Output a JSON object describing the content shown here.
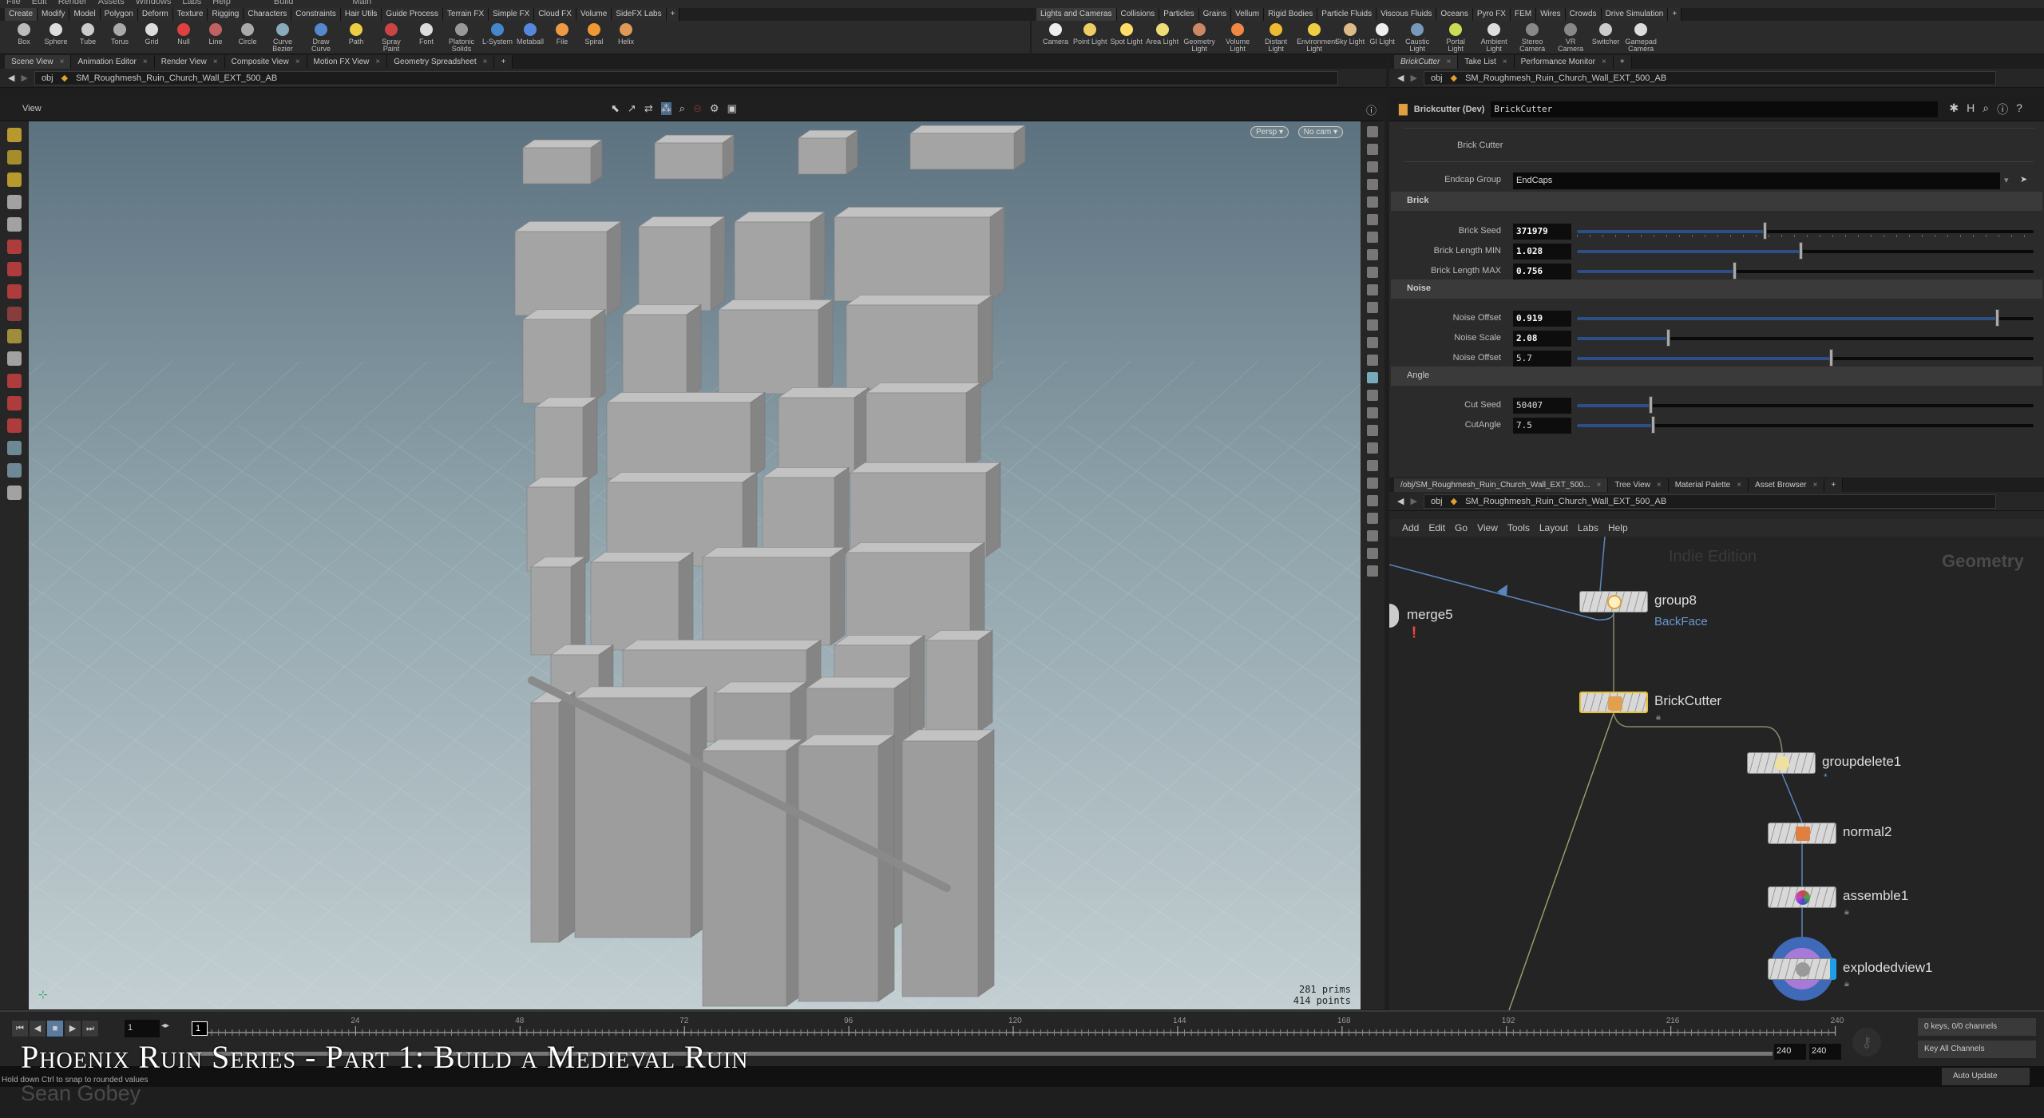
{
  "menubar": {
    "items": [
      "File",
      "Edit",
      "Render",
      "Assets",
      "Windows",
      "Labs",
      "Help"
    ],
    "desktop": "Build",
    "context": "Main"
  },
  "shelf_left": {
    "tabs": [
      "Create",
      "Modify",
      "Model",
      "Polygon",
      "Deform",
      "Texture",
      "Rigging",
      "Characters",
      "Constraints",
      "Hair Utils",
      "Guide Process",
      "Terrain FX",
      "Simple FX",
      "Cloud FX",
      "Volume",
      "SideFX Labs"
    ],
    "tools": [
      "Box",
      "Sphere",
      "Tube",
      "Torus",
      "Grid",
      "Null",
      "Line",
      "Circle",
      "Curve Bezier",
      "Draw Curve",
      "Path",
      "Spray Paint",
      "Font",
      "Platonic Solids",
      "L-System",
      "Metaball",
      "File",
      "Spiral",
      "Helix"
    ]
  },
  "shelf_right": {
    "tabs": [
      "Lights and Cameras",
      "Collisions",
      "Particles",
      "Grains",
      "Vellum",
      "Rigid Bodies",
      "Particle Fluids",
      "Viscous Fluids",
      "Oceans",
      "Pyro FX",
      "FEM",
      "Wires",
      "Crowds",
      "Drive Simulation"
    ],
    "tools": [
      "Camera",
      "Point Light",
      "Spot Light",
      "Area Light",
      "Geometry Light",
      "Volume Light",
      "Distant Light",
      "Environment Light",
      "Sky Light",
      "GI Light",
      "Caustic Light",
      "Portal Light",
      "Ambient Light",
      "Stereo Camera",
      "VR Camera",
      "Switcher",
      "Gamepad Camera"
    ]
  },
  "left_pane": {
    "tabs": [
      "Scene View",
      "Animation Editor",
      "Render View",
      "Composite View",
      "Motion FX View",
      "Geometry Spreadsheet"
    ],
    "path_root": "obj",
    "path_node": "SM_Roughmesh_Ruin_Church_Wall_EXT_500_AB",
    "view_label": "View",
    "persp": "Persp ▾",
    "cam": "No cam ▾",
    "stats": {
      "prims": "281  prims",
      "points": "414 points"
    }
  },
  "right_pane": {
    "tabs": [
      "BrickCutter",
      "Take List",
      "Performance Monitor"
    ],
    "path_root": "obj",
    "path_node": "SM_Roughmesh_Ruin_Church_Wall_EXT_500_AB"
  },
  "params": {
    "node_type": "Brickcutter (Dev)",
    "node_name": "BrickCutter",
    "heading": "Brick Cutter",
    "endcap_label": "Endcap Group",
    "endcap_value": "EndCaps",
    "sections": [
      "Brick",
      "Noise",
      "Angle"
    ],
    "rows": [
      {
        "label": "Brick Seed",
        "value": "371979",
        "fill": 0.41,
        "bold": true
      },
      {
        "label": "Brick Length MIN",
        "value": "1.028",
        "fill": 0.49,
        "bold": true
      },
      {
        "label": "Brick Length MAX",
        "value": "0.756",
        "fill": 0.345,
        "bold": true
      },
      {
        "label": "Noise Offset",
        "value": "0.919",
        "fill": 0.92,
        "bold": true
      },
      {
        "label": "Noise Scale",
        "value": "2.08",
        "fill": 0.2,
        "bold": true
      },
      {
        "label": "Noise Offset",
        "value": "5.7",
        "fill": 0.556,
        "bold": false
      },
      {
        "label": "Cut Seed",
        "value": "50407",
        "fill": 0.16,
        "bold": false
      },
      {
        "label": "CutAngle",
        "value": "7.5",
        "fill": 0.166,
        "bold": false
      }
    ]
  },
  "network": {
    "tabs": [
      "/obj/SM_Roughmesh_Ruin_Church_Wall_EXT_500...",
      "Tree View",
      "Material Palette",
      "Asset Browser"
    ],
    "path_root": "obj",
    "path_node": "SM_Roughmesh_Ruin_Church_Wall_EXT_500_AB",
    "menu": [
      "Add",
      "Edit",
      "Go",
      "View",
      "Tools",
      "Layout",
      "Labs",
      "Help"
    ],
    "watermark": "Indie Edition",
    "context": "Geometry",
    "nodes": {
      "merge5": "merge5",
      "group8": "group8",
      "group8_sub": "BackFace",
      "brickcutter": "BrickCutter",
      "groupdelete": "groupdelete1",
      "groupdelete_sub": "*",
      "normal": "normal2",
      "assemble": "assemble1",
      "exploded": "explodedview1"
    }
  },
  "timeline": {
    "current_frame": "1",
    "frame_marker": "1",
    "ticks": [
      "24",
      "48",
      "72",
      "96",
      "120",
      "144",
      "168",
      "192",
      "216",
      "240"
    ],
    "end": "240",
    "range_end": "240",
    "keys": "0 keys, 0/0 channels",
    "key_mode": "Key All Channels",
    "update": "Auto Update"
  },
  "status": "Hold down Ctrl to snap to rounded values",
  "overlay": {
    "title": "Phoenix Ruin Series - Part 1: Build a Medieval Ruin",
    "author": "Sean Gobey"
  },
  "colors": {
    "accent_blue": "#2b4f86",
    "selected_node": "#e8c030",
    "display_flag": "#1ea0e8"
  }
}
